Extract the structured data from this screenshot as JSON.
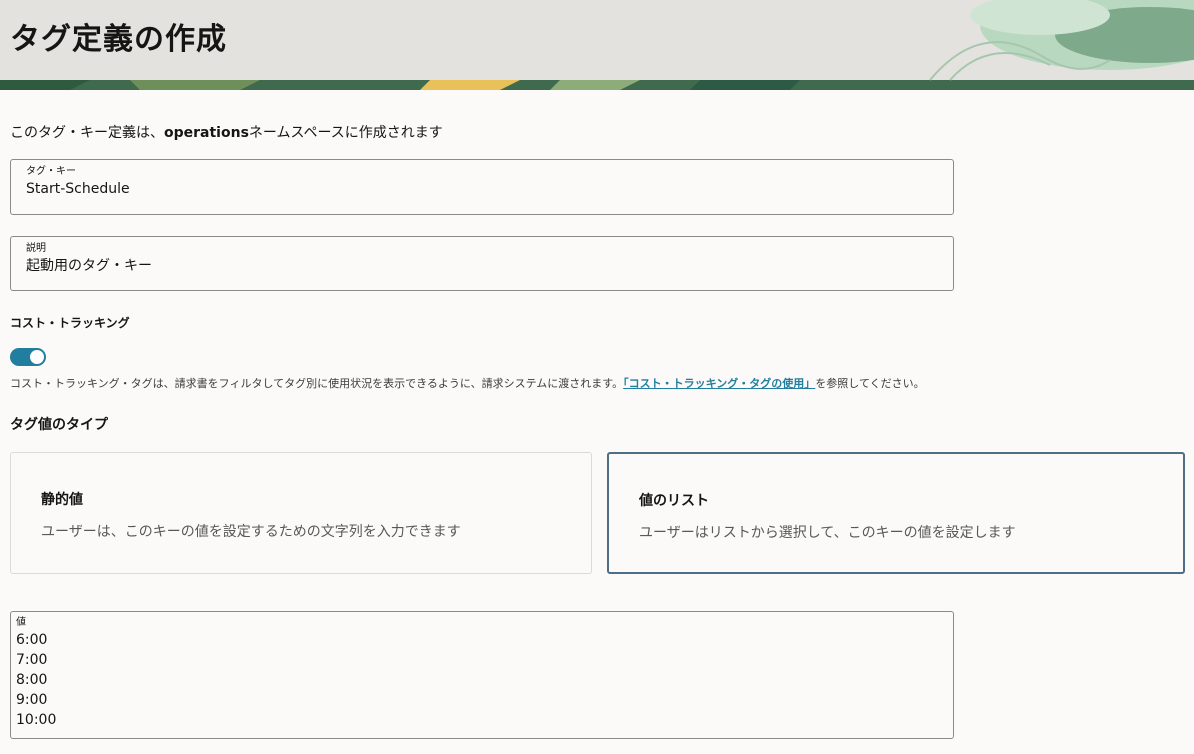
{
  "header": {
    "title": "タグ定義の作成"
  },
  "intro": {
    "prefix": "このタグ・キー定義は、",
    "namespace": "operations",
    "suffix": "ネームスペースに作成されます"
  },
  "tag_key": {
    "label": "タグ・キー",
    "value": "Start-Schedule"
  },
  "description": {
    "label": "説明",
    "value": "起動用のタグ・キー"
  },
  "cost_tracking": {
    "label": "コスト・トラッキング",
    "enabled": true,
    "help_text": "コスト・トラッキング・タグは、請求書をフィルタしてタグ別に使用状況を表示できるように、請求システムに渡されます。",
    "help_link": "「コスト・トラッキング・タグの使用」",
    "help_suffix": "を参照してください。"
  },
  "value_type": {
    "label": "タグ値のタイプ",
    "options": [
      {
        "title": "静的値",
        "desc": "ユーザーは、このキーの値を設定するための文字列を入力できます",
        "selected": false
      },
      {
        "title": "値のリスト",
        "desc": "ユーザーはリストから選択して、このキーの値を設定します",
        "selected": true
      }
    ]
  },
  "values": {
    "label": "値",
    "lines": [
      "6:00",
      "7:00",
      "8:00",
      "9:00",
      "10:00"
    ]
  },
  "colors": {
    "accent": "#227e9e",
    "selected_border": "#4e6e85",
    "header_bg": "#e4e2df"
  }
}
